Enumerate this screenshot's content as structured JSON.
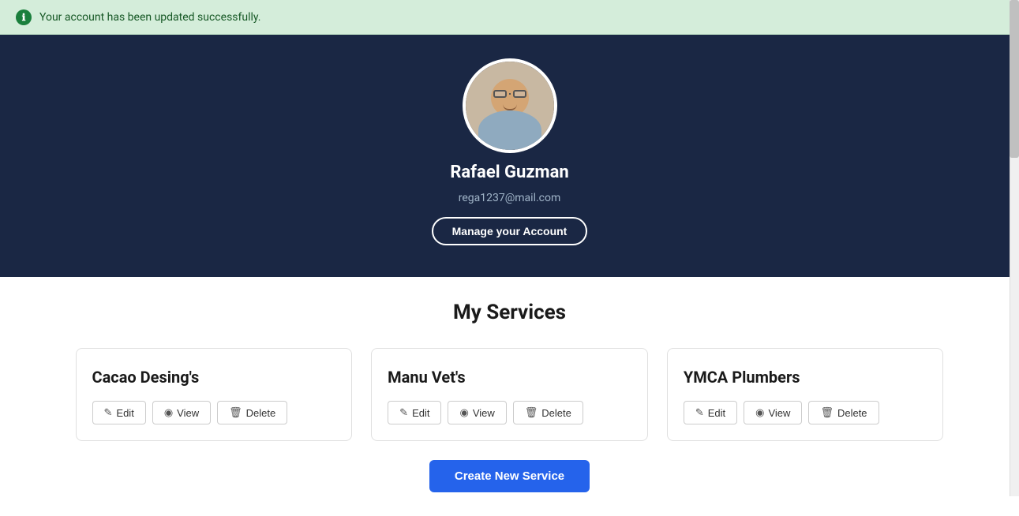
{
  "banner": {
    "message": "Your account has been updated successfully.",
    "icon": "ℹ"
  },
  "profile": {
    "name": "Rafael Guzman",
    "email": "rega1237@mail.com",
    "manage_btn_label": "Manage your Account"
  },
  "services_section": {
    "title": "My Services",
    "services": [
      {
        "id": 1,
        "name": "Cacao Desing's"
      },
      {
        "id": 2,
        "name": "Manu Vet's"
      },
      {
        "id": 3,
        "name": "YMCA Plumbers"
      }
    ],
    "actions": [
      "Edit",
      "View",
      "Delete"
    ],
    "create_btn_label": "Create New Service"
  },
  "icons": {
    "info": "ℹ",
    "edit": "✎",
    "view": "👁",
    "delete": "🗑"
  }
}
